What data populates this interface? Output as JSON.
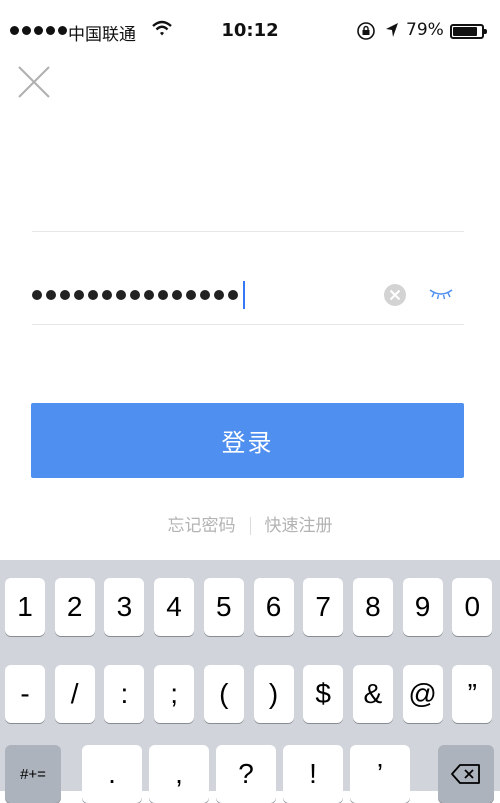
{
  "status_bar": {
    "carrier": "中国联通",
    "time": "10:12",
    "battery": "79%",
    "battery_level": 0.79
  },
  "password_field": {
    "mask": "•••••••••••••••",
    "length": 15
  },
  "login_button": "登录",
  "links": {
    "forgot_password": "忘记密码",
    "quick_register": "快速注册"
  },
  "keyboard": {
    "row1": [
      "1",
      "2",
      "3",
      "4",
      "5",
      "6",
      "7",
      "8",
      "9",
      "0"
    ],
    "row2": [
      "-",
      "/",
      ":",
      ";",
      "(",
      ")",
      "$",
      "&",
      "@",
      "”"
    ],
    "row3": [
      "#+=",
      ".",
      ",",
      "?",
      "!",
      "’"
    ]
  },
  "colors": {
    "accent": "#4f8ff0",
    "link": "#b3b3b3",
    "keyboard_bg": "#d1d5db"
  }
}
